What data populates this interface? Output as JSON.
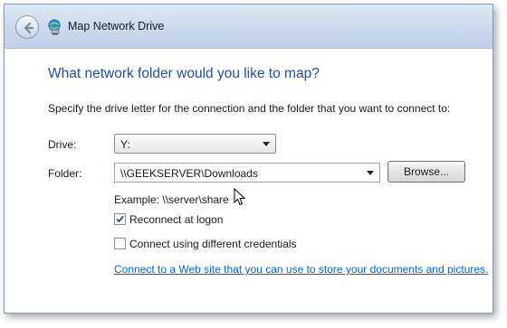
{
  "window": {
    "title": "Map Network Drive"
  },
  "heading": "What network folder would you like to map?",
  "instructions": "Specify the drive letter for the connection and the folder that you want to connect to:",
  "drive": {
    "label": "Drive:",
    "value": "Y:"
  },
  "folder": {
    "label": "Folder:",
    "value": "\\\\GEEKSERVER\\Downloads",
    "browse_label": "Browse..."
  },
  "example": "Example: \\\\server\\share",
  "options": {
    "reconnect_label": "Reconnect at logon",
    "reconnect_checked": true,
    "credentials_label": "Connect using different credentials",
    "credentials_checked": false
  },
  "link": "Connect to a Web site that you can use to store your documents and pictures.",
  "colors": {
    "heading": "#1f4e9c",
    "link": "#0066cc",
    "titlebar": "#c9d9ee"
  }
}
